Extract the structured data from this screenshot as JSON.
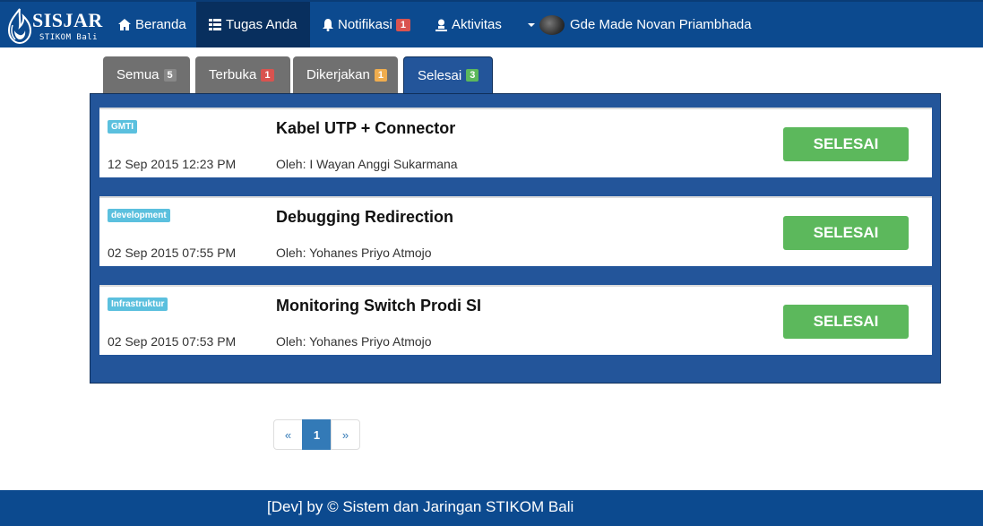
{
  "brand": {
    "title": "SISJAR",
    "subtitle": "STIKOM Bali"
  },
  "nav": {
    "home": "Beranda",
    "tasks": "Tugas Anda",
    "notifications": "Notifikasi",
    "notifications_count": "1",
    "activity": "Aktivitas",
    "user": "Gde Made Novan Priambhada"
  },
  "tabs": [
    {
      "label": "Semua",
      "count": "5",
      "color": "#888888"
    },
    {
      "label": "Terbuka",
      "count": "1",
      "color": "#d9534f"
    },
    {
      "label": "Dikerjakan",
      "count": "1",
      "color": "#f0ad4e"
    },
    {
      "label": "Selesai",
      "count": "3",
      "color": "#5cb85c"
    }
  ],
  "tasks": [
    {
      "tag": "GMTI",
      "title": "Kabel UTP + Connector",
      "date": "12 Sep 2015 12:23 PM",
      "by": "Oleh: I Wayan Anggi Sukarmana",
      "button": "SELESAI"
    },
    {
      "tag": "development",
      "title": "Debugging Redirection",
      "date": "02 Sep 2015 07:55 PM",
      "by": "Oleh: Yohanes Priyo Atmojo",
      "button": "SELESAI"
    },
    {
      "tag": "Infrastruktur",
      "title": "Monitoring Switch Prodi SI",
      "date": "02 Sep 2015 07:53 PM",
      "by": "Oleh: Yohanes Priyo Atmojo",
      "button": "SELESAI"
    }
  ],
  "pagination": {
    "prev": "«",
    "current": "1",
    "next": "»"
  },
  "footer": "[Dev] by © Sistem dan Jaringan STIKOM Bali",
  "colors": {
    "navbar": "#0c4a8f",
    "panel": "#23559a",
    "success": "#5cb85c",
    "tag": "#5bc0de"
  }
}
